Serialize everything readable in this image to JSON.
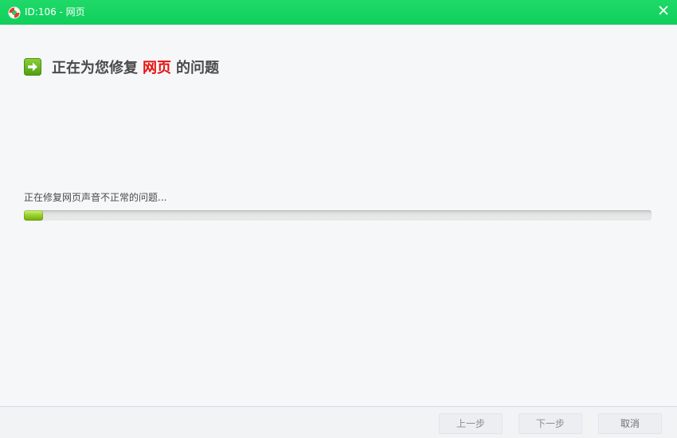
{
  "window": {
    "title": "ID:106 - 网页",
    "accent_color": "#13d35f",
    "app_icon": "lifebuoy-icon",
    "close_icon": "close-icon"
  },
  "heading": {
    "icon": "arrow-right-icon",
    "prefix": "正在为您修复",
    "highlight": "网页",
    "suffix": "的问题",
    "highlight_color": "#e8110f"
  },
  "progress": {
    "status_text": "正在修复网页声音不正常的问题...",
    "fraction": 0.03
  },
  "footer": {
    "prev_label": "上一步",
    "next_label": "下一步",
    "cancel_label": "取消"
  }
}
